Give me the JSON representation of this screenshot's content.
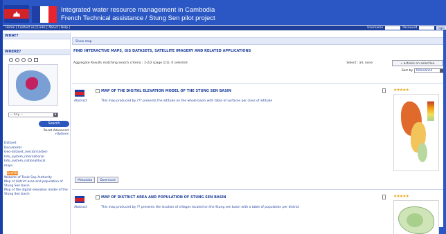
{
  "header": {
    "title_line1": "Integrated water resource management in Cambodia",
    "title_line2": "French Technical assistance / Stung Sen pilot project"
  },
  "topnav": {
    "links": "Home | Contact us | Links | About | Help |",
    "username_label": "Username",
    "password_label": "Password",
    "login_label": "login"
  },
  "sidebar": {
    "what_label": "WHAT?",
    "where_label": "WHERE?",
    "any_option": "-- Any --",
    "search_label": "Search",
    "reset_label": "Reset",
    "advanced_label": "Advanced",
    "options_label": "»Options",
    "categories": [
      "Dataset",
      "Documents",
      "Geo-dataset_(vector/raster)",
      "Info_system_international",
      "Info_system_national/local",
      "maps"
    ],
    "rss_label": "GeoRSS",
    "rss_items": [
      "Website of Tonle Sap Authority",
      "Map of district area and population of Stung Sen basin",
      "Map of the digital elevation model of the Stung Sen basin"
    ]
  },
  "main": {
    "show_map": "Show map",
    "find_heading": "FIND INTERACTIVE MAPS, GIS DATASETS, SATELLITE IMAGERY AND RELATED APPLICATIONS",
    "aggregate_text": "Aggregate Results matching search criteria :   1-2/2   (page 1/1),   0 selected",
    "select_text": "Select : all, none",
    "actions_label": "» actions on selection",
    "sort_label": "Sort by",
    "sort_value": "Relevance",
    "results": [
      {
        "title": "MAP OF THE DIGITAL ELEVATION MODEL OF THE STUNG SEN BASIN",
        "abstract_label": "Abstract",
        "abstract": "This map produced by ??? presents the altitude on the whole basin with table of surfaces per class of altitude",
        "stars": "★★★★★",
        "metadata_label": "Metadata",
        "download_label": "Download"
      },
      {
        "title": "MAP OF DISTRICT AREA AND POPULATION OF STUNG SEN BASIN",
        "abstract_label": "Abstract",
        "abstract": "This map produced by ?? presents the location of villages located on the Stung sen basin with a table of population per district",
        "stars": "★★★★★"
      }
    ]
  }
}
